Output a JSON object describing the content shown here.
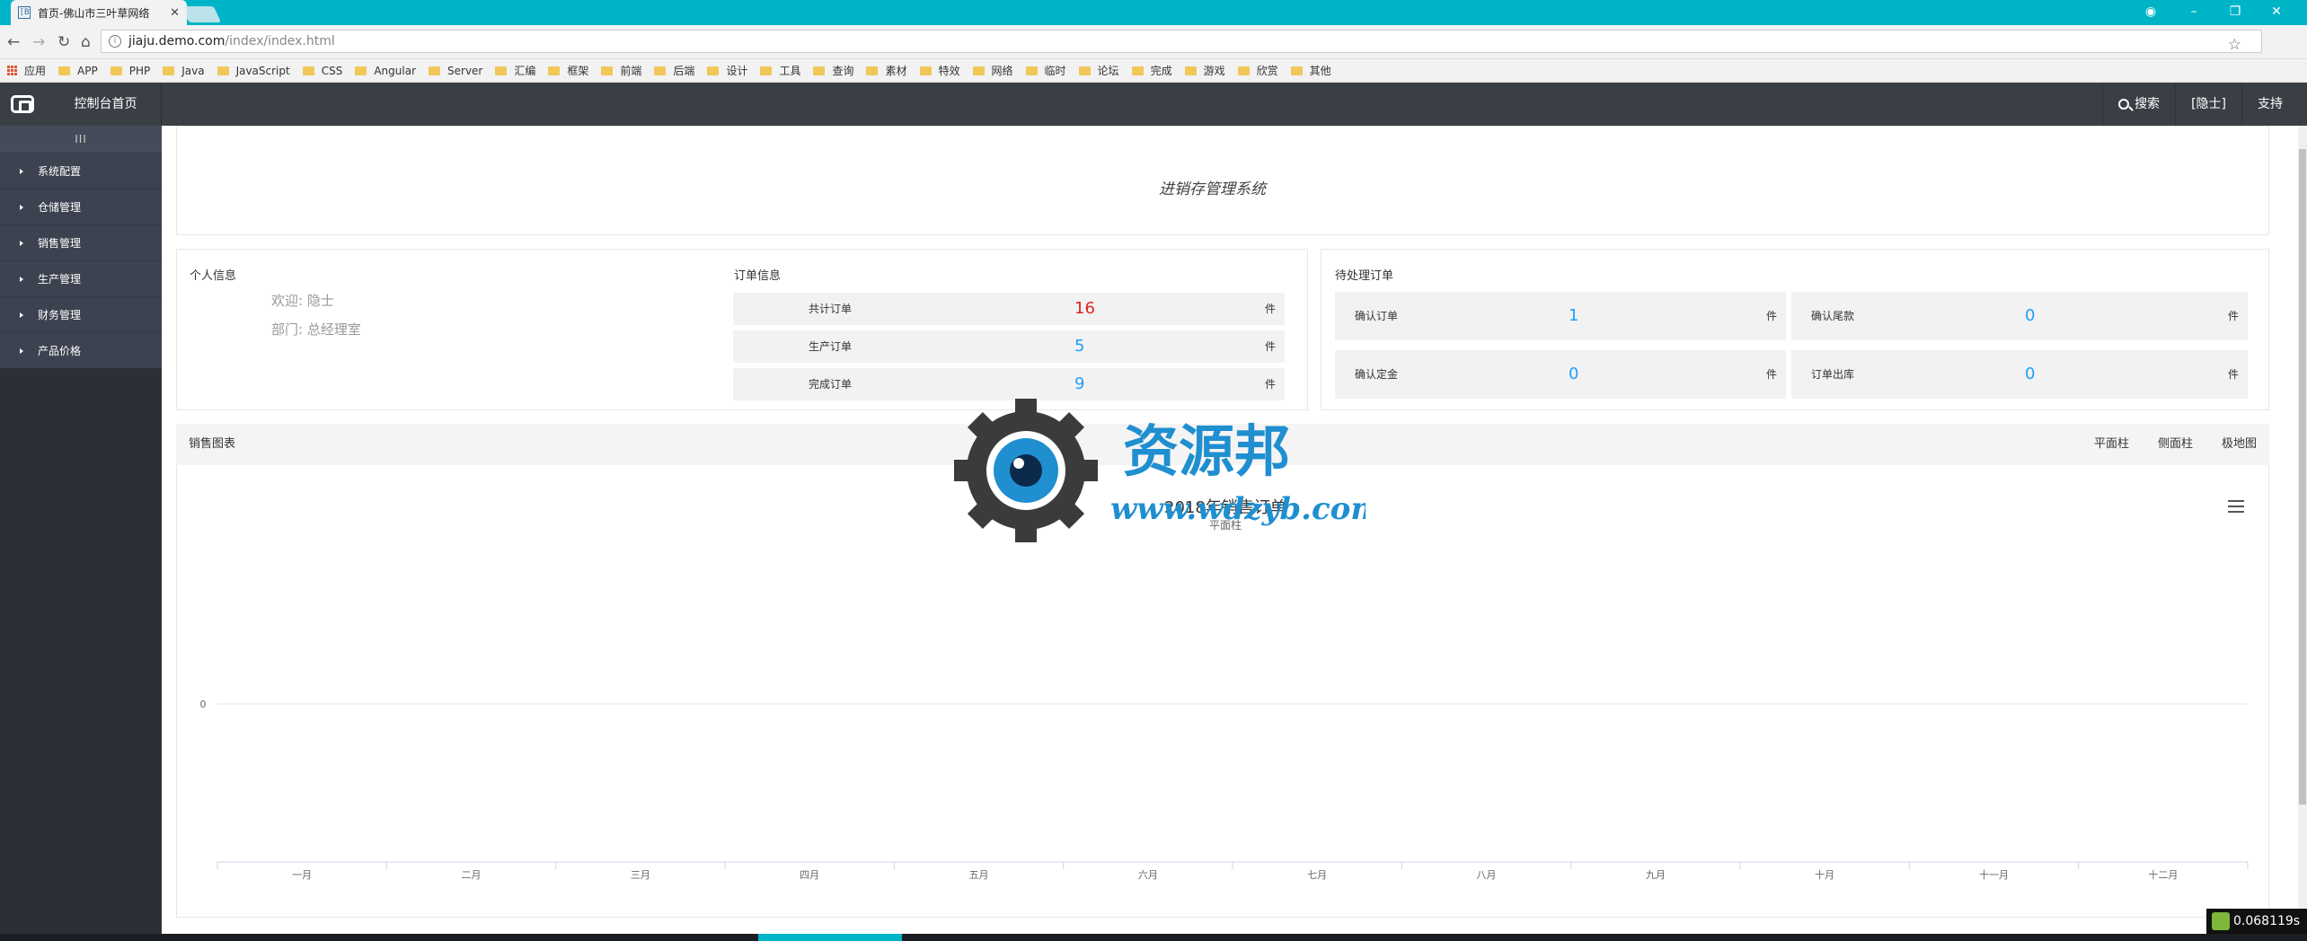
{
  "browser": {
    "tab_title": "首页-佛山市三叶草网络",
    "tab_favicon": "[B",
    "tab_close": "✕",
    "url_host": "jiaju.demo.com",
    "url_path": "/index/index.html",
    "bookmarks": [
      "应用",
      "APP",
      "PHP",
      "Java",
      "JavaScript",
      "CSS",
      "Angular",
      "Server",
      "汇编",
      "框架",
      "前端",
      "后端",
      "设计",
      "工具",
      "查询",
      "素材",
      "特效",
      "网络",
      "临时",
      "论坛",
      "完成",
      "游戏",
      "欣赏",
      "其他"
    ]
  },
  "header": {
    "home_label": "控制台首页",
    "search_label": "搜索",
    "user_label": "[隐士]",
    "support_label": "支持"
  },
  "sidebar": {
    "toggle_label": "III",
    "items": [
      {
        "label": "系统配置"
      },
      {
        "label": "仓储管理"
      },
      {
        "label": "销售管理"
      },
      {
        "label": "生产管理"
      },
      {
        "label": "财务管理"
      },
      {
        "label": "产品价格"
      }
    ]
  },
  "banner": {
    "title": "进销存管理系统"
  },
  "personal": {
    "title": "个人信息",
    "welcome": "欢迎: 隐士",
    "department": "部门: 总经理室"
  },
  "orders": {
    "title": "订单信息",
    "rows": [
      {
        "label": "共计订单",
        "value": "16",
        "unit": "件"
      },
      {
        "label": "生产订单",
        "value": "5",
        "unit": "件"
      },
      {
        "label": "完成订单",
        "value": "9",
        "unit": "件"
      }
    ]
  },
  "pending": {
    "title": "待处理订单",
    "cells": [
      {
        "label": "确认订单",
        "value": "1",
        "unit": "件"
      },
      {
        "label": "确认尾款",
        "value": "0",
        "unit": "件"
      },
      {
        "label": "确认定金",
        "value": "0",
        "unit": "件"
      },
      {
        "label": "订单出库",
        "value": "0",
        "unit": "件"
      }
    ]
  },
  "chart_panel": {
    "title": "销售图表",
    "buttons": [
      "平面柱",
      "侧面柱",
      "极地图"
    ]
  },
  "chart_data": {
    "type": "bar",
    "title": "2018年销售订单",
    "subtitle": "平面柱",
    "categories": [
      "一月",
      "二月",
      "三月",
      "四月",
      "五月",
      "六月",
      "七月",
      "八月",
      "九月",
      "十月",
      "十一月",
      "十二月"
    ],
    "values": [
      0,
      0,
      0,
      0,
      0,
      0,
      0,
      0,
      0,
      0,
      0,
      0
    ],
    "ytick_labels": [
      "0"
    ],
    "xlabel": "",
    "ylabel": ""
  },
  "watermark": {
    "name": "资源邦",
    "url": "www.wdzyb.com"
  },
  "timer": {
    "value": "0.068119s"
  },
  "colors": {
    "accent": "#1e9fff",
    "total_orders": "#e02020",
    "tabbar": "#00b4c8",
    "sidebar": "#2b2f36"
  }
}
